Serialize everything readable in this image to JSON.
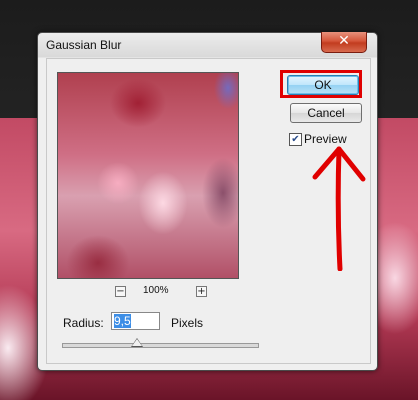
{
  "window": {
    "title": "Gaussian Blur",
    "close_glyph": "✕"
  },
  "preview": {
    "zoom_level": "100%",
    "zoom_out": "−",
    "zoom_in": "+"
  },
  "buttons": {
    "ok": "OK",
    "cancel": "Cancel"
  },
  "preview_option": {
    "label": "Preview",
    "checked": true,
    "check_glyph": "✔"
  },
  "radius": {
    "label": "Radius:",
    "value": "9,5",
    "unit": "Pixels",
    "slider_fraction": 0.38
  },
  "annotation": {
    "color": "#e00000"
  }
}
